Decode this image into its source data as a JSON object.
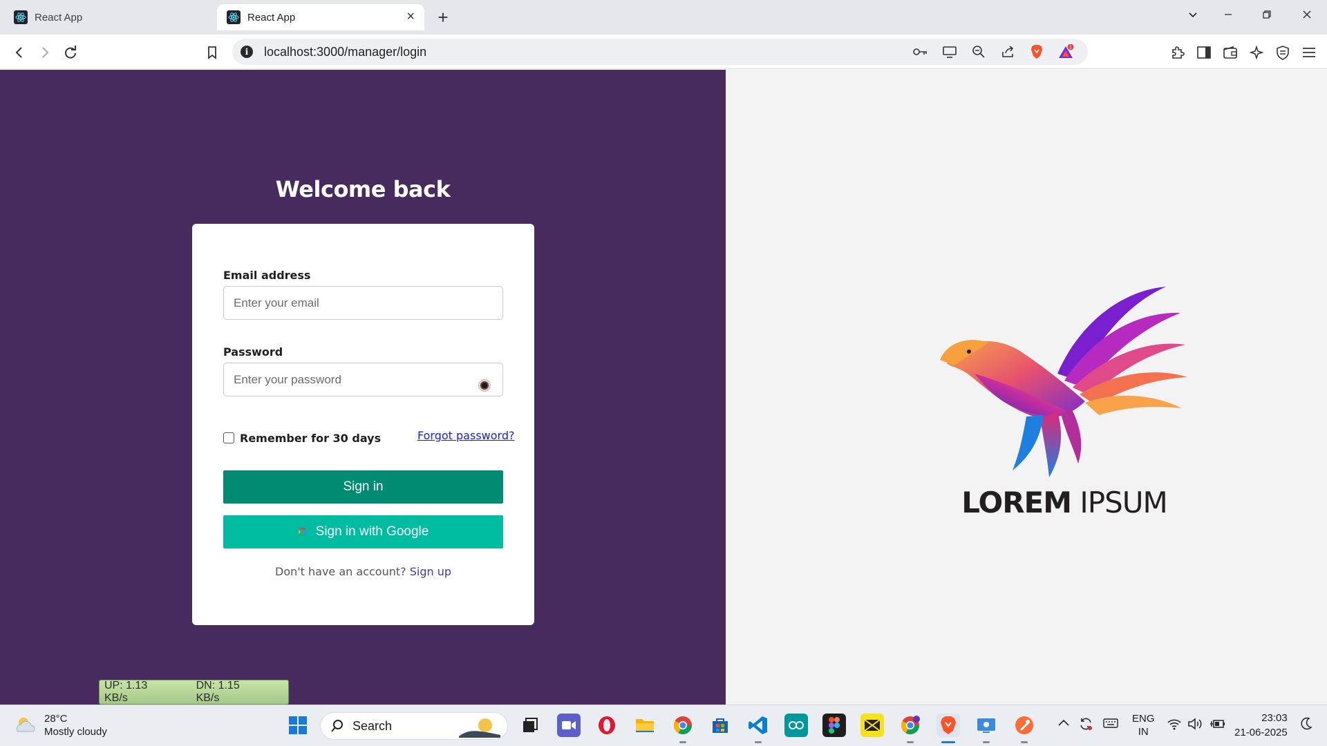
{
  "browser": {
    "tabs": [
      {
        "title": "React App",
        "active": false
      },
      {
        "title": "React App",
        "active": true
      }
    ],
    "url": "localhost:3000/manager/login",
    "notification_count": "1"
  },
  "login": {
    "heading": "Welcome back",
    "email_label": "Email address",
    "email_placeholder": "Enter your email",
    "password_label": "Password",
    "password_placeholder": "Enter your password",
    "remember_label": "Remember for 30 days",
    "forgot_link": "Forgot password?",
    "signin_button": "Sign in",
    "google_button": "Sign in with Google",
    "signup_prompt": "Don't have an account?",
    "signup_link": "Sign up"
  },
  "brand": {
    "logo_bold": "LOREM",
    "logo_light": "IPSUM"
  },
  "netmeter": {
    "up": "UP: 1.13 KB/s",
    "down": "DN: 1.15 KB/s"
  },
  "taskbar": {
    "weather_temp": "28°C",
    "weather_desc": "Mostly cloudy",
    "search_label": "Search",
    "language_line1": "ENG",
    "language_line2": "IN",
    "time": "23:03",
    "date": "21-06-2025"
  },
  "colors": {
    "left_pane": "#472a5e",
    "signin_button": "#008c72",
    "google_button": "#00bda2"
  }
}
